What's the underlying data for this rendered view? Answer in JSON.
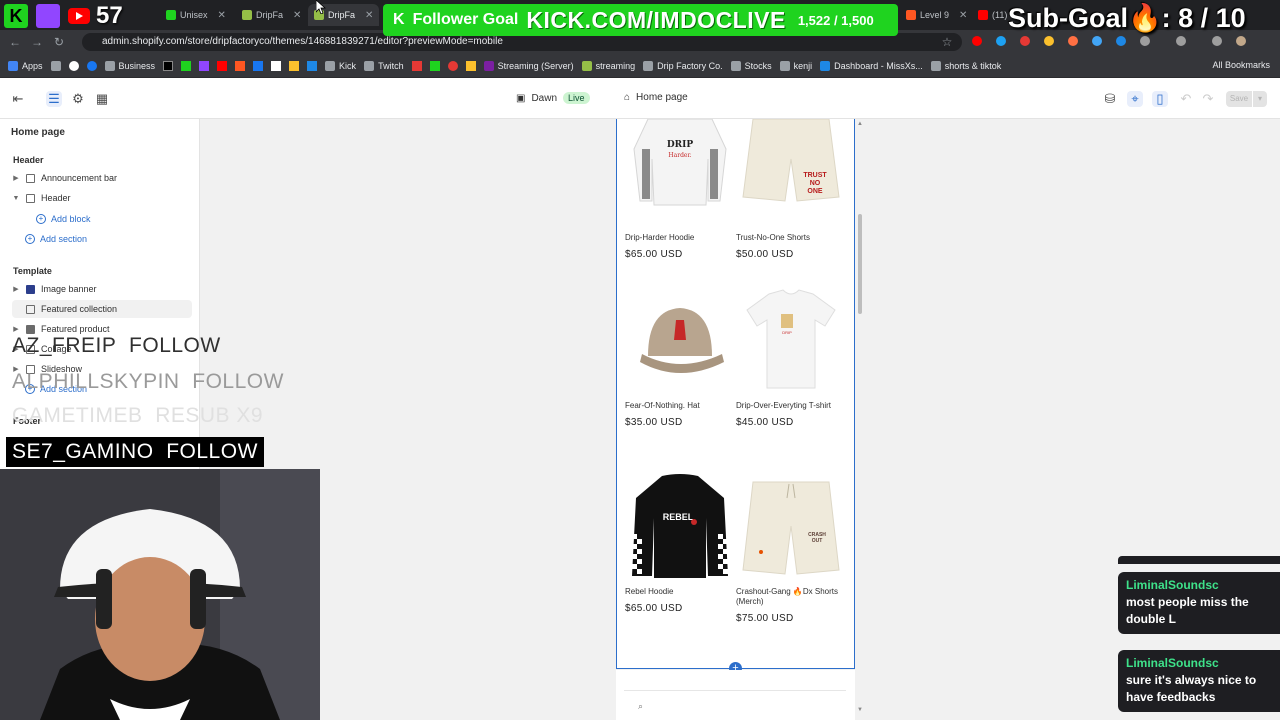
{
  "browser": {
    "tabs": [
      {
        "label": "Unisex",
        "color": "#1fd31f"
      },
      {
        "label": "DripFa",
        "color": "#95bf47"
      },
      {
        "label": "DripFa",
        "color": "#95bf47"
      },
      {
        "label": "Level 9",
        "color": "#ff5722"
      },
      {
        "label": "(11)",
        "color": "#ff0000"
      }
    ],
    "url": "admin.shopify.com/store/dripfactoryco/themes/146881839271/editor?previewMode=mobile",
    "bookmarks": [
      {
        "label": "Apps"
      },
      {
        "label": "Business"
      },
      {
        "label": "Kick"
      },
      {
        "label": "Twitch"
      },
      {
        "label": "Streaming (Server)"
      },
      {
        "label": "streaming"
      },
      {
        "label": "Drip Factory Co."
      },
      {
        "label": "Stocks"
      },
      {
        "label": "kenji"
      },
      {
        "label": "Dashboard - MissXs..."
      },
      {
        "label": "shorts & tiktok"
      }
    ],
    "all_bookmarks": "All Bookmarks"
  },
  "editor": {
    "theme_name": "Dawn",
    "live_badge": "Live",
    "page_name": "Home page",
    "save_label": "Save"
  },
  "sidebar": {
    "title": "Home page",
    "header_group": "Header",
    "announcement_bar": "Announcement bar",
    "header_item": "Header",
    "add_block": "Add block",
    "add_section": "Add section",
    "template_group": "Template",
    "template_items": [
      "Image banner",
      "Featured collection",
      "Featured product",
      "Collage",
      "Slideshow"
    ],
    "add_section_2": "Add section",
    "footer_group": "Footer"
  },
  "products": [
    {
      "name": "Drip-Harder Hoodie",
      "price": "$65.00 USD"
    },
    {
      "name": "Trust-No-One Shorts",
      "price": "$50.00 USD"
    },
    {
      "name": "Fear-Of-Nothing. Hat",
      "price": "$35.00 USD"
    },
    {
      "name": "Drip-Over-Everyting T-shirt",
      "price": "$45.00 USD"
    },
    {
      "name": "Rebel Hoodie",
      "price": "$65.00 USD"
    },
    {
      "name": "Crashout-Gang 🔥Dx Shorts (Merch)",
      "price": "$75.00 USD"
    }
  ],
  "overlay": {
    "viewer_count": "57",
    "follower_goal_label": "Follower Goal",
    "follower_goal_url": "KICK.COM/IMDOCLIVE",
    "follower_goal_count": "1,522 / 1,500",
    "sub_goal": "Sub-Goal🔥: 8 / 10",
    "alerts": [
      {
        "name": "AZ_FREIP",
        "action": "FOLLOW"
      },
      {
        "name": "ALPHILLSKYPIN",
        "action": "FOLLOW"
      },
      {
        "name": "GAMETIMEB",
        "action": "RESUB X9"
      },
      {
        "name": "SE7_GAMINO",
        "action": "FOLLOW"
      }
    ],
    "chat": [
      {
        "user": "LiminalSoundsc",
        "message": "most people miss the double L"
      },
      {
        "user": "LiminalSoundsc",
        "message": "sure it's always nice to have feedbacks"
      }
    ]
  }
}
